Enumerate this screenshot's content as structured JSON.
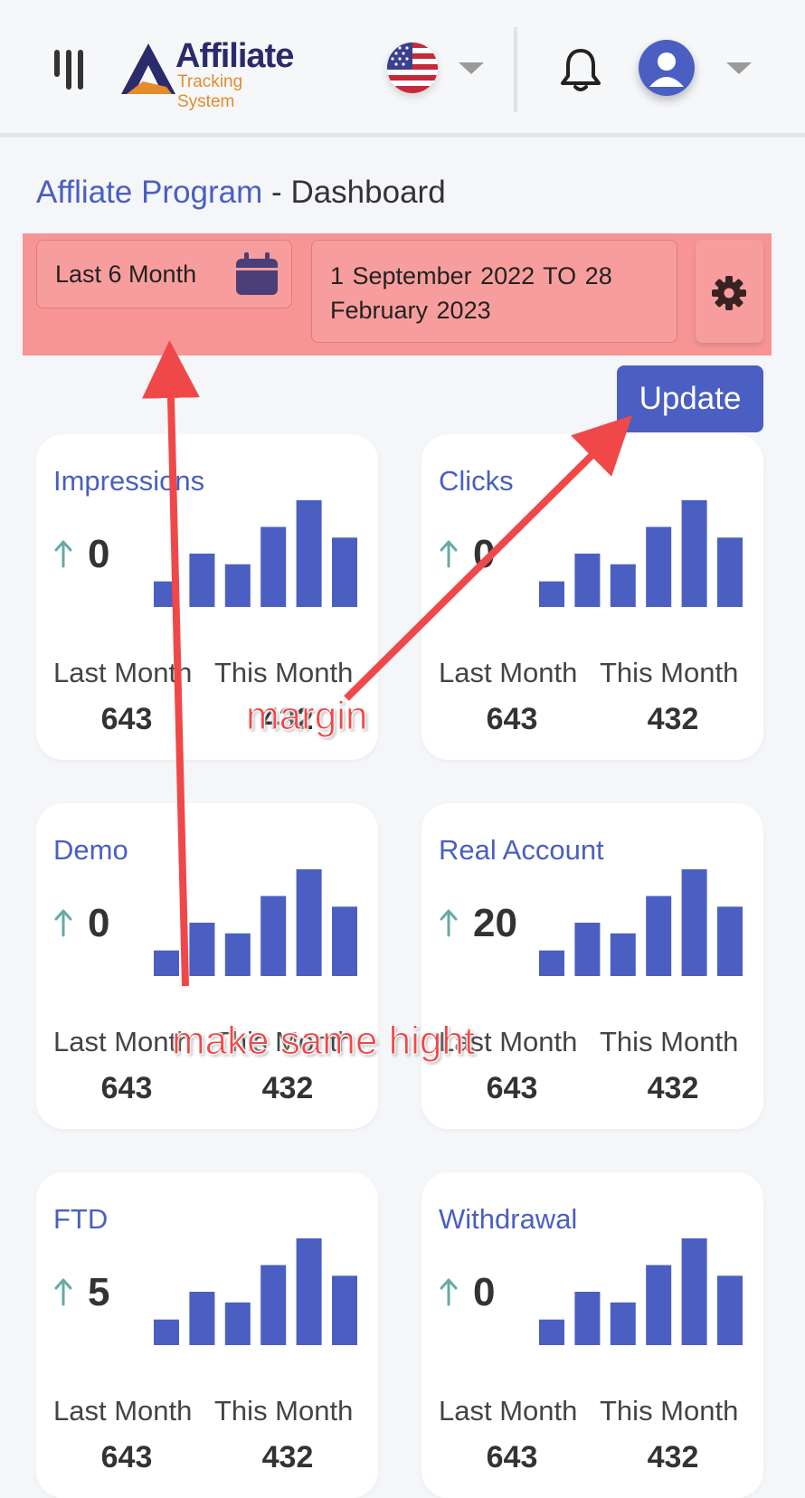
{
  "header": {
    "logo_main": "Affiliate",
    "logo_sub": "Tracking System",
    "icons": [
      "menu-icon",
      "us-flag-icon",
      "chevron-down-icon",
      "bell-icon",
      "user-avatar-icon"
    ]
  },
  "title": {
    "program": "Affliate Program",
    "separator": "-",
    "page": "Dashboard"
  },
  "filters": {
    "period": "Last 6 Month",
    "range": "1 September 2022    TO   28 February 2023",
    "update": "Update"
  },
  "colors": {
    "accent": "#4a5fc1",
    "highlight": "#f79595",
    "trend": "#66aaa8",
    "annotation": "#f04848"
  },
  "cards": [
    {
      "title": "Impressions",
      "value": "0",
      "last_label": "Last Month",
      "this_label": "This Month",
      "last": "643",
      "this": "432"
    },
    {
      "title": "Clicks",
      "value": "0",
      "last_label": "Last Month",
      "this_label": "This Month",
      "last": "643",
      "this": "432"
    },
    {
      "title": "Demo",
      "value": "0",
      "last_label": "Last Month",
      "this_label": "This Month",
      "last": "643",
      "this": "432"
    },
    {
      "title": "Real Account",
      "value": "20",
      "last_label": "Last Month",
      "this_label": "This Month",
      "last": "643",
      "this": "432"
    },
    {
      "title": "FTD",
      "value": "5",
      "last_label": "Last Month",
      "this_label": "This Month",
      "last": "643",
      "this": "432"
    },
    {
      "title": "Withdrawal",
      "value": "0",
      "last_label": "Last Month",
      "this_label": "This Month",
      "last": "643",
      "this": "432"
    }
  ],
  "sparkline": [
    0.24,
    0.5,
    0.4,
    0.75,
    1.0,
    0.65
  ],
  "annotations": {
    "margin": "margin",
    "same_height": "make same hight"
  }
}
